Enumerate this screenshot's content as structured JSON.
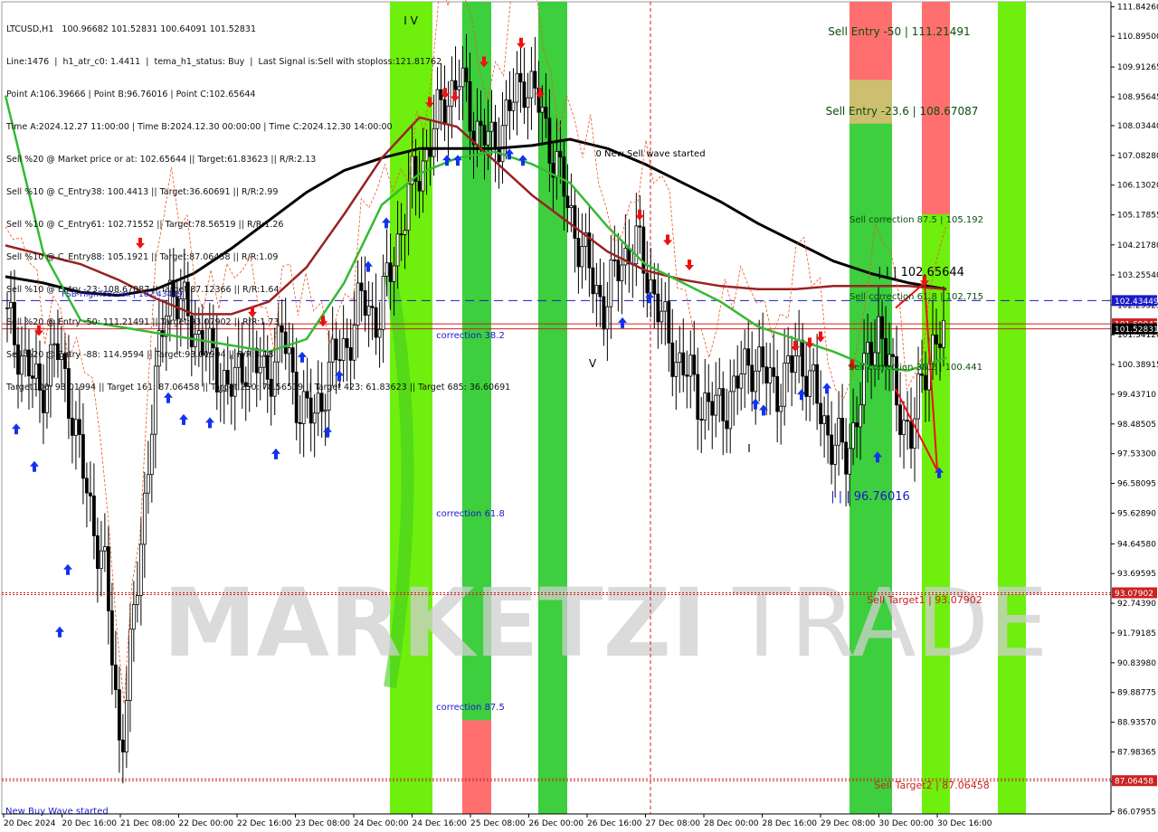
{
  "header": {
    "lines": [
      "LTCUSD,H1   100.96682 101.52831 100.64091 101.52831",
      "Line:1476  |  h1_atr_c0: 1.4411  |  tema_h1_status: Buy  |  Last Signal is:Sell with stoploss:121.81762",
      "Point A:106.39666 | Point B:96.76016 | Point C:102.65644",
      "Time A:2024.12.27 11:00:00 | Time B:2024.12.30 00:00:00 | Time C:2024.12.30 14:00:00",
      "Sell %20 @ Market price or at: 102.65644 || Target:61.83623 || R/R:2.13",
      "Sell %10 @ C_Entry38: 100.4413 || Target:36.60691 || R/R:2.99",
      "Sell %10 @ C_Entry61: 102.71552 || Target:78.56519 || R/R:1.26",
      "Sell %10 @ C_Entry88: 105.1921 || Target:87.06458 || R/R:1.09",
      "Sell %10 @ Entry -23: 108.67087 || Target:87.12366 || R/R:1.64",
      "Sell %20 @ Entry -50: 111.21491 || Target:93.07902 || R/R:1.73",
      "Sell %20 @ Entry -88: 114.9594 || Target:93.01994 || R/R:3.18",
      "Target100: 93.01994 || Target 161: 87.06458 || Target 250: 78.56519 || Target 423: 61.83623 || Target 685: 36.60691"
    ]
  },
  "colors": {
    "bg": "#ffffff",
    "green_bright": "#66ee00",
    "green_mid": "#33cc33",
    "red_zone": "#ff6f6f",
    "up_candle": "#000000",
    "ma_black": "#000000",
    "ma_darkred": "#992222",
    "ma_green": "#33bb33",
    "hline_blue": "#1a1acc",
    "hline_red": "#cc2222",
    "text_blue": "#1a1acc",
    "text_darkgreen": "#0c4d0c",
    "watermark": "#d0d0d0"
  },
  "watermark": {
    "text_bold": "MARKETZI",
    "text_light": "TRADE"
  },
  "chart_data": {
    "type": "candlestick",
    "symbol": "LTCUSD",
    "timeframe": "H1",
    "ylim": [
      86.0,
      112.0
    ],
    "y_ticks": [
      "111.84260",
      "110.89500",
      "109.91265",
      "108.95645",
      "108.03440",
      "107.08280",
      "106.13020",
      "105.17855",
      "104.21780",
      "103.25540",
      "102.29325",
      "101.34120",
      "100.38915",
      "99.43710",
      "98.48505",
      "97.53300",
      "96.58095",
      "95.62890",
      "94.64580",
      "93.69595",
      "92.74390",
      "91.79185",
      "90.83980",
      "89.88775",
      "88.93570",
      "87.98365",
      "87.03160",
      "86.07955"
    ],
    "x_ticks": [
      "20 Dec 2024",
      "20 Dec 16:00",
      "21 Dec 08:00",
      "22 Dec 00:00",
      "22 Dec 16:00",
      "23 Dec 08:00",
      "24 Dec 00:00",
      "24 Dec 16:00",
      "25 Dec 08:00",
      "26 Dec 00:00",
      "26 Dec 16:00",
      "27 Dec 08:00",
      "28 Dec 00:00",
      "28 Dec 16:00",
      "29 Dec 08:00",
      "30 Dec 00:00",
      "30 Dec 16:00"
    ],
    "price_tags": [
      {
        "value": 102.43449,
        "label": "102.43449",
        "color": "#1a1acc"
      },
      {
        "value": 101.69042,
        "label": "101.69042",
        "color": "#cc2222"
      },
      {
        "value": 101.52831,
        "label": "101.52831",
        "color": "#000000"
      },
      {
        "value": 93.07902,
        "label": "93.07902",
        "color": "#cc2222"
      },
      {
        "value": 87.06458,
        "label": "87.06458",
        "color": "#cc2222"
      }
    ],
    "h_lines": [
      {
        "value": 102.43449,
        "color": "#1a1acc",
        "style": "dashed",
        "label": "FSB-HighToBreak | 102.43449"
      },
      {
        "value": 101.69042,
        "color": "#cc2222",
        "style": "solid",
        "label": ""
      },
      {
        "value": 101.52831,
        "color": "#cc2222",
        "style": "solid",
        "label": ""
      },
      {
        "value": 93.07902,
        "color": "#cc2222",
        "style": "dotted",
        "label": ""
      },
      {
        "value": 93.01994,
        "color": "#cc2222",
        "style": "dotted",
        "label": ""
      },
      {
        "value": 87.06458,
        "color": "#cc2222",
        "style": "dotted",
        "label": ""
      },
      {
        "value": 87.12366,
        "color": "#cc2222",
        "style": "dotted",
        "label": ""
      }
    ],
    "annotations": [
      {
        "text": "Sell Entry -50 | 111.21491",
        "color": "#0c4d0c",
        "size": 12
      },
      {
        "text": "Sell Entry -23.6 | 108.67087",
        "color": "#0c4d0c",
        "size": 12
      },
      {
        "text": "Sell correction 87.5 | 105.192",
        "color": "#0c4d0c",
        "size": 10
      },
      {
        "text": "Sell correction 61.8 | 102.715",
        "color": "#0c4d0c",
        "size": 10
      },
      {
        "text": "Sell correction 38.2 | 100.441",
        "color": "#0c4d0c",
        "size": 10
      },
      {
        "text": "| | | 102.65644",
        "color": "#000000",
        "size": 13
      },
      {
        "text": "| | | 96.76016",
        "color": "#1a1acc",
        "size": 13
      },
      {
        "text": "0 New Sell wave started",
        "color": "#000000",
        "size": 10
      },
      {
        "text": "correction 38.2",
        "color": "#1a1acc",
        "size": 10
      },
      {
        "text": "correction 61.8",
        "color": "#1a1acc",
        "size": 10
      },
      {
        "text": "correction 87.5",
        "color": "#1a1acc",
        "size": 10
      },
      {
        "text": "Sell Target1 | 93.07902",
        "color": "#cc2222",
        "size": 11
      },
      {
        "text": "Sell Target2 | 87.06458",
        "color": "#cc2222",
        "size": 11
      },
      {
        "text": "New Buy Wave started",
        "color": "#1a1acc",
        "size": 10
      },
      {
        "text": "FSB-HighToBreak | 102.43449",
        "color": "#1a1acc",
        "size": 9
      },
      {
        "text": "I V",
        "color": "#000000",
        "size": 12
      },
      {
        "text": "V",
        "color": "#000000",
        "size": 12
      },
      {
        "text": "I",
        "color": "#000000",
        "size": 12
      }
    ],
    "zones": [
      {
        "kind": "green-bright",
        "from": 112.0,
        "to": 86.0
      },
      {
        "kind": "green-mid",
        "from": 112.0,
        "to": 86.0
      },
      {
        "kind": "red",
        "from": 112.0,
        "to": 86.0
      }
    ],
    "candles_ohlc_sample": {
      "note_free": true,
      "seed_closes": [
        101.8,
        100.6,
        99.4,
        101.0,
        99.0,
        96.0,
        94.0,
        88.0,
        93.0,
        99.0,
        103.0,
        102.0,
        101.2,
        100.2,
        99.6,
        100.8,
        99.8,
        101.4,
        99.2,
        98.6,
        100.3,
        101.0,
        102.5,
        101.8,
        104.0,
        106.0,
        107.2,
        108.8,
        109.5,
        108.0,
        107.4,
        108.4,
        109.6,
        108.6,
        106.8,
        105.0,
        103.4,
        102.2,
        103.8,
        104.2,
        102.8,
        101.0,
        100.2,
        99.2,
        98.9,
        99.5,
        100.6,
        100.0,
        99.6,
        100.9,
        99.4,
        98.0,
        97.4,
        99.8,
        101.8,
        99.4,
        98.0,
        100.8,
        101.2
      ]
    },
    "series": [
      {
        "name": "",
        "color": "#000000",
        "values": [
          103.2,
          103.0,
          102.7,
          102.6,
          102.8,
          103.3,
          104.1,
          105.0,
          105.9,
          106.6,
          107.0,
          107.3,
          107.3,
          107.3,
          107.4,
          107.6,
          107.3,
          106.8,
          106.2,
          105.6,
          104.9,
          104.3,
          103.7,
          103.3,
          103.0,
          102.8
        ]
      },
      {
        "name": "",
        "color": "#992222",
        "values": [
          104.2,
          103.9,
          103.6,
          103.1,
          102.5,
          102.0,
          102.0,
          102.4,
          103.5,
          105.2,
          107.0,
          108.3,
          108.0,
          106.9,
          105.8,
          104.9,
          104.0,
          103.4,
          103.1,
          102.9,
          102.8,
          102.8,
          102.9,
          102.9,
          102.9,
          102.8
        ]
      },
      {
        "name": "",
        "color": "#33bb33",
        "values": [
          109.0,
          104.0,
          101.8,
          101.6,
          101.4,
          101.2,
          101.0,
          100.8,
          101.2,
          103.0,
          105.5,
          106.5,
          107.0,
          107.2,
          106.8,
          106.2,
          104.8,
          103.6,
          103.0,
          102.4,
          101.6,
          101.2,
          100.8,
          100.3,
          100.2,
          100.6
        ]
      }
    ]
  }
}
